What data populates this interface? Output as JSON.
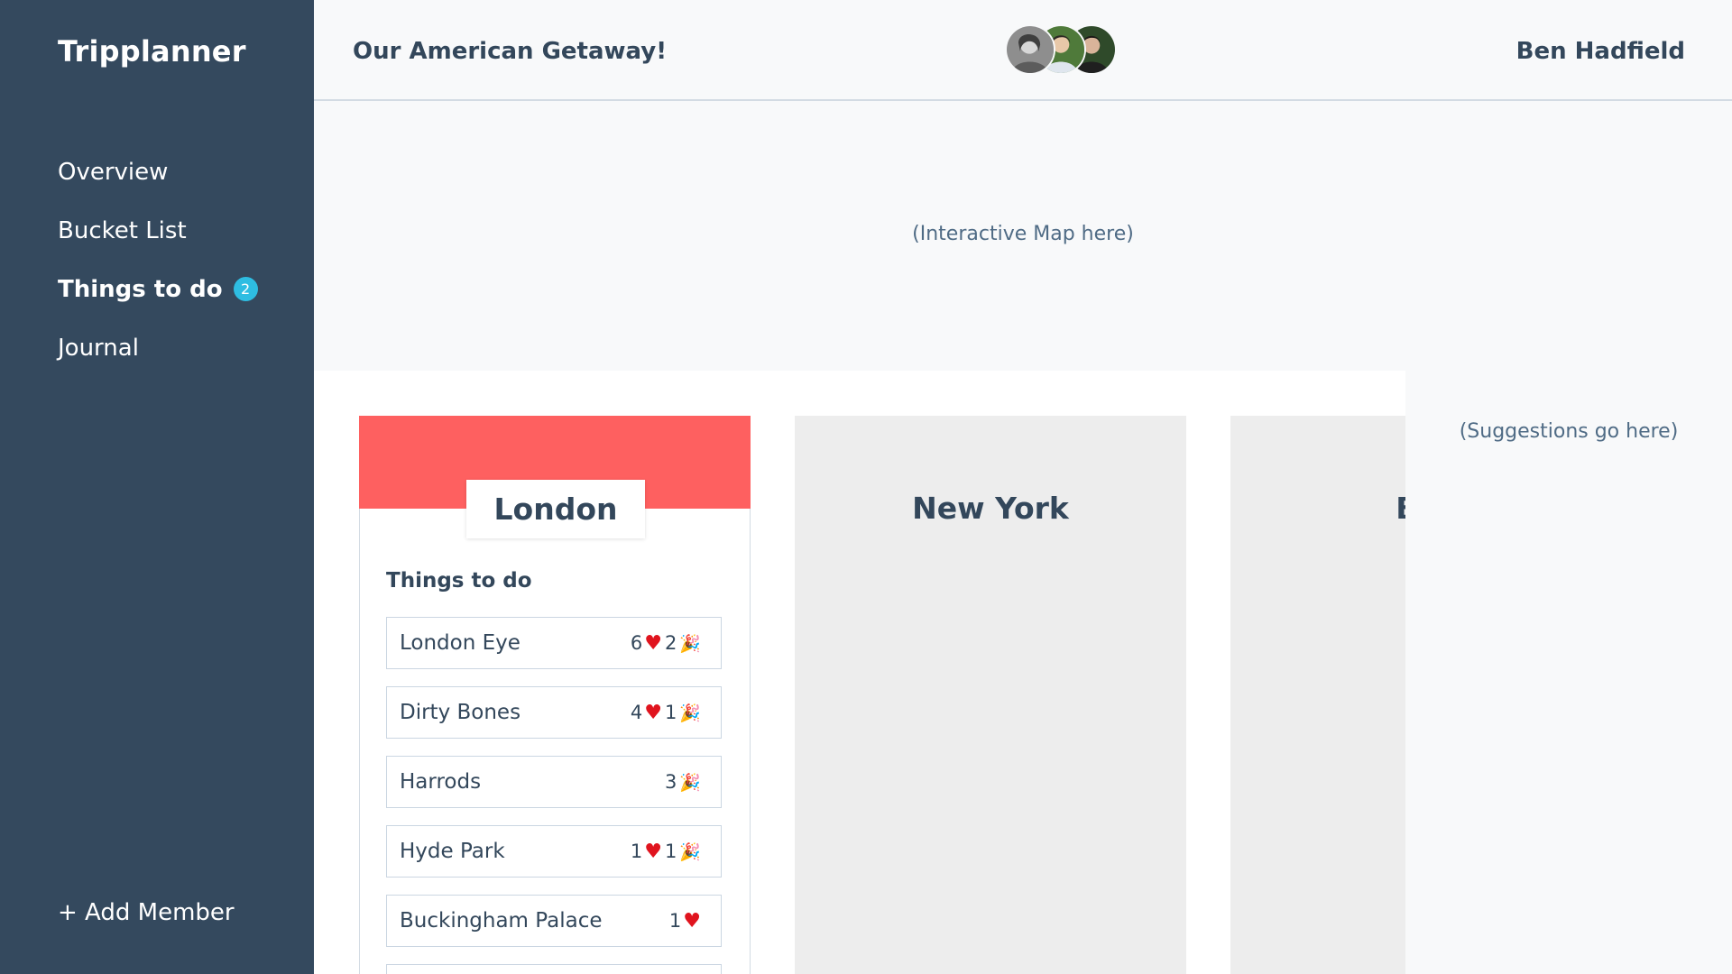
{
  "app": {
    "brand": "Tripplanner"
  },
  "sidebar": {
    "items": [
      {
        "label": "Overview"
      },
      {
        "label": "Bucket List"
      },
      {
        "label": "Things to do",
        "badge": "2",
        "active": true
      },
      {
        "label": "Journal"
      }
    ],
    "add_member": "+ Add Member"
  },
  "header": {
    "trip_title": "Our American Getaway!",
    "user_name": "Ben Hadfield"
  },
  "map": {
    "placeholder": "(Interactive Map here)"
  },
  "suggestions": {
    "placeholder": "(Suggestions go here)"
  },
  "cities": [
    {
      "name": "London",
      "section_title": "Things to do",
      "todos": [
        {
          "name": "London Eye",
          "likes": "6",
          "parties": "2"
        },
        {
          "name": "Dirty Bones",
          "likes": "4",
          "parties": "1"
        },
        {
          "name": "Harrods",
          "parties": "3"
        },
        {
          "name": "Hyde Park",
          "likes": "1",
          "parties": "1"
        },
        {
          "name": "Buckingham Palace",
          "likes": "1"
        }
      ]
    },
    {
      "name": "New York"
    },
    {
      "name": "Bos"
    }
  ],
  "icons": {
    "heart": "heart-icon",
    "party": "party-popper-icon"
  },
  "colors": {
    "sidebar": "#34495e",
    "accent_london": "#fe6060",
    "badge": "#2ebde2",
    "text": "#33475b"
  }
}
